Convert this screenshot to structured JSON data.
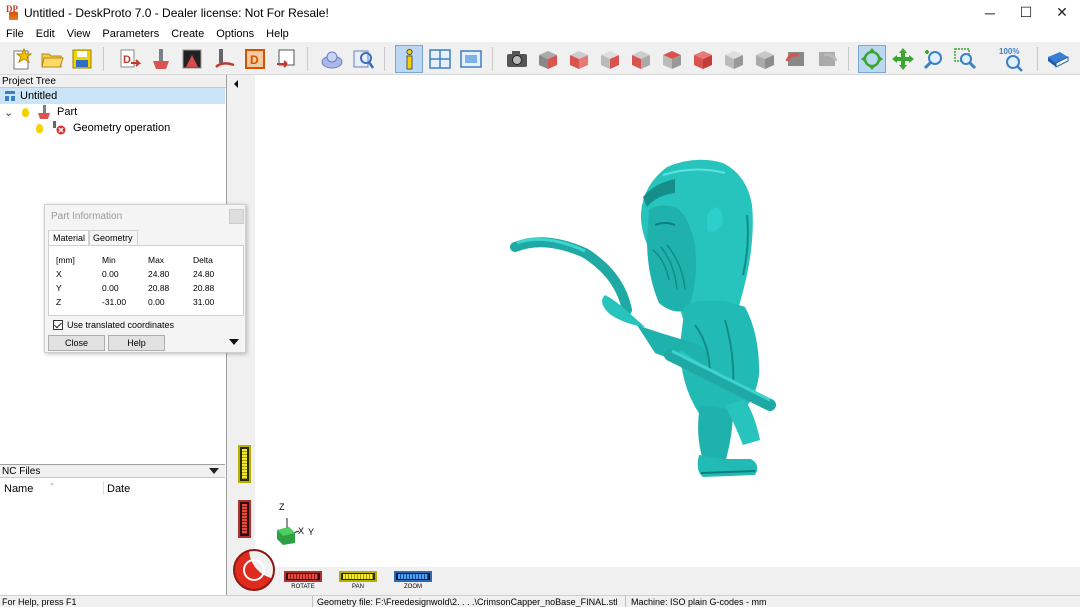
{
  "window": {
    "title": "Untitled - DeskProto 7.0 - Dealer license: Not For Resale!",
    "logo_text": "DP",
    "minimize": "─",
    "maximize": "☐",
    "close": "✕"
  },
  "menu": [
    "File",
    "Edit",
    "View",
    "Parameters",
    "Create",
    "Options",
    "Help"
  ],
  "toolbar": {
    "zoom_level": "100%"
  },
  "project_tree": {
    "header": "Project Tree",
    "root": "Untitled",
    "part": "Part",
    "operation": "Geometry operation",
    "collapse_glyph": "⌄"
  },
  "nc_files": {
    "header": "NC Files",
    "col_name": "Name",
    "col_date": "Date"
  },
  "part_info": {
    "title": "Part Information",
    "tabs": [
      "Material",
      "Geometry"
    ],
    "headers": [
      "[mm]",
      "Min",
      "Max",
      "Delta"
    ],
    "rows": [
      [
        "X",
        "0.00",
        "24.80",
        "24.80"
      ],
      [
        "Y",
        "0.00",
        "20.88",
        "20.88"
      ],
      [
        "Z",
        "-31.00",
        "0.00",
        "31.00"
      ]
    ],
    "checkbox_label": "Use translated coordinates",
    "close": "Close",
    "help": "Help"
  },
  "axes": {
    "z": "Z",
    "x": "X",
    "y": "Y"
  },
  "nav": {
    "rotate": "ROTATE",
    "pan": "PAN",
    "zoom": "ZOOM"
  },
  "status": {
    "help": "For Help, press F1",
    "geometry": "Geometry file: F:\\Freedesignwold\\2. . . .\\CrimsonCapper_noBase_FINAL.stl",
    "machine": "Machine: ISO plain G-codes - mm"
  },
  "colors": {
    "model": "#27c3bd",
    "model_dark": "#138c88",
    "selection": "#cce4f7",
    "active_tool": "#bcd7f2"
  }
}
